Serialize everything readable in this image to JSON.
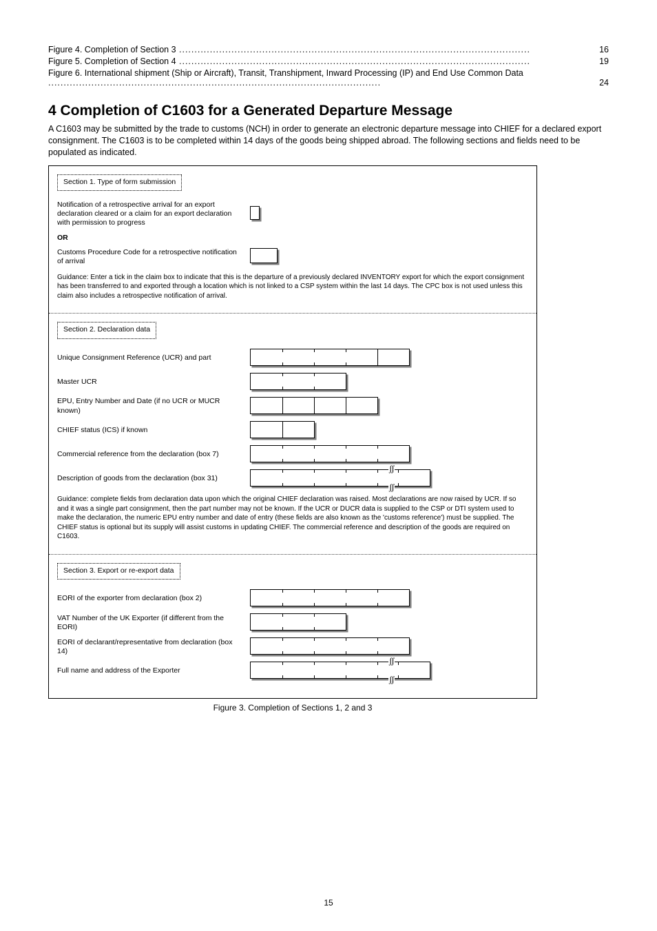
{
  "toc": [
    {
      "text": "Figure 4. Completion of Section 3",
      "page": "16"
    },
    {
      "text": "Figure 5. Completion of Section 4",
      "page": "19"
    },
    {
      "text": "Figure 6. International shipment (Ship or Aircraft), Transit, Transhipment, Inward Processing (IP) and End Use Common Data",
      "page": "24"
    }
  ],
  "heading": "4 Completion of C1603 for a Generated Departure Message",
  "paragraph": "A C1603 may be submitted by the trade to customs (NCH) in order to generate an electronic departure message into CHIEF for a declared export consignment. The C1603 is to be completed within 14 days of the goods being shipped abroad. The following sections and fields need to be populated as indicated.",
  "section1": {
    "box_label": "Section 1. Type of form submission",
    "rows": [
      {
        "label": "Notification of a retrospective arrival for an export declaration cleared or a claim for an export declaration with permission to progress",
        "box": "tiny"
      },
      {
        "label": "OR",
        "box": null
      },
      {
        "label": "Customs Procedure Code for a retrospective notification of arrival",
        "box": "small"
      }
    ],
    "guidance": "Guidance: Enter a tick in the claim box to indicate that this is the departure of a previously declared INVENTORY export for which the export consignment has been transferred to and exported through a location which is not linked to a CSP system within the last 14 days. The CPC box is not used unless this claim also includes a retrospective notification of arrival."
  },
  "section2": {
    "box_label": "Section 2. Declaration data",
    "rows": [
      {
        "label": "Unique Consignment Reference (UCR) and part",
        "segs": 5,
        "hard_after": [
          4
        ],
        "value_seg": 0,
        "value": ""
      },
      {
        "label": "Master UCR",
        "segs": 3,
        "hard_after": []
      },
      {
        "label": "EPU, Entry Number and Date (if no UCR or MUCR known)",
        "segs": 4,
        "hard_after": [
          1,
          2,
          3
        ]
      },
      {
        "label": "CHIEF status (ICS) if known",
        "segs": 2,
        "hard_after": [
          1
        ]
      },
      {
        "label": "Commercial reference from the declaration (box 7)",
        "segs": 5,
        "hard_after": []
      },
      {
        "label": "Description of goods from the declaration (box 31)",
        "segs": 6,
        "hard_after": [],
        "broken": true
      }
    ],
    "guidance": "Guidance: complete fields from declaration data upon which the original CHIEF declaration was raised. Most declarations are now raised by UCR. If so and it was a single part consignment, then the part number may not be known. If the UCR or DUCR data is supplied to the CSP or DTI system used to make the declaration, the numeric EPU entry number and date of entry (these fields are also known as the 'customs reference') must be supplied. The CHIEF status is optional but its supply will assist customs in updating CHIEF. The commercial reference and description of the goods are required on C1603."
  },
  "section3": {
    "box_label": "Section 3. Export or re-export data",
    "rows": [
      {
        "label": "EORI of the exporter from declaration (box 2)",
        "segs": 5,
        "hard_after": []
      },
      {
        "label": "VAT Number of the UK Exporter (if different from the EORI)",
        "segs": 3,
        "hard_after": []
      },
      {
        "label": "EORI of declarant/representative from declaration (box 14)",
        "segs": 5,
        "hard_after": []
      },
      {
        "label": "Full name and address of the Exporter",
        "segs": 6,
        "hard_after": [],
        "broken": true
      }
    ]
  },
  "fig_caption": "Figure 3. Completion of Sections 1, 2 and 3",
  "page_number": "15"
}
